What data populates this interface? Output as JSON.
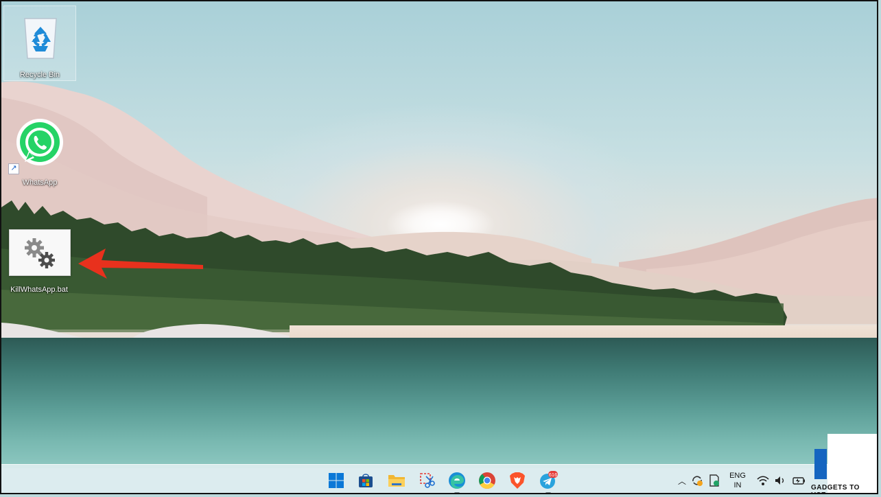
{
  "desktop": {
    "icons": [
      {
        "label": "Recycle Bin",
        "icon": "recycle-bin-icon"
      },
      {
        "label": "WhatsApp",
        "icon": "whatsapp-icon"
      },
      {
        "label": "KillWhatsApp.bat",
        "icon": "batch-file-gears-icon"
      }
    ],
    "annotation": {
      "type": "red-arrow",
      "color": "#e8311d",
      "points_to": "KillWhatsApp.bat"
    }
  },
  "taskbar": {
    "apps": [
      {
        "name": "windows-start",
        "icon": "windows-logo-icon"
      },
      {
        "name": "microsoft-store",
        "icon": "store-icon"
      },
      {
        "name": "file-explorer",
        "icon": "folder-icon"
      },
      {
        "name": "snipping-tool",
        "icon": "scissors-icon"
      },
      {
        "name": "microsoft-edge",
        "icon": "edge-icon",
        "running": true
      },
      {
        "name": "google-chrome",
        "icon": "chrome-icon"
      },
      {
        "name": "brave-browser",
        "icon": "brave-lion-icon"
      },
      {
        "name": "telegram",
        "icon": "telegram-icon",
        "badge": "616",
        "running": true
      }
    ],
    "tray": {
      "chevron": "chevron-up-icon",
      "language_line1": "ENG",
      "language_line2": "IN",
      "icons": [
        "onedrive-sync-icon",
        "security-icon",
        "wifi-icon",
        "speaker-icon",
        "battery-icon"
      ]
    }
  },
  "watermark": "GADGETS TO USE",
  "colors": {
    "taskbar_bg": "#deeef0",
    "arrow": "#e8311d",
    "whatsapp_green": "#25d366",
    "telegram_blue": "#2aa3dd",
    "brave_orange": "#fb542b"
  }
}
